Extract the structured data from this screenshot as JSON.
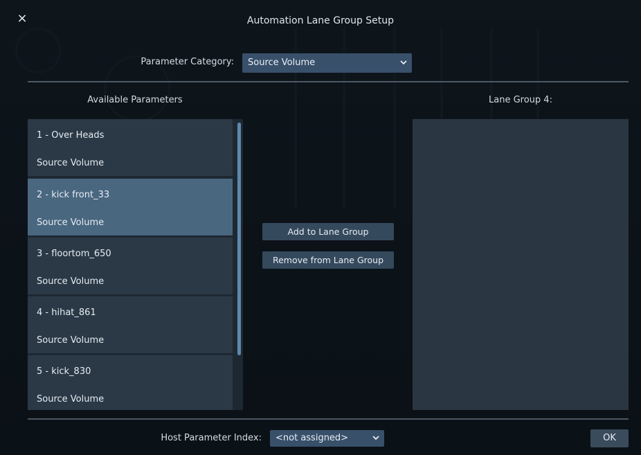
{
  "dialog": {
    "title": "Automation Lane Group Setup",
    "close_glyph": "×"
  },
  "parameter_category": {
    "label": "Parameter Category:",
    "selected": "Source Volume"
  },
  "available": {
    "header": "Available Parameters",
    "items": [
      {
        "name": "1 - Over Heads",
        "parameter": "Source Volume",
        "selected": false
      },
      {
        "name": "2 - kick front_33",
        "parameter": "Source Volume",
        "selected": true
      },
      {
        "name": "3 - floortom_650",
        "parameter": "Source Volume",
        "selected": false
      },
      {
        "name": "4 - hihat_861",
        "parameter": "Source Volume",
        "selected": false
      },
      {
        "name": "5 - kick_830",
        "parameter": "Source Volume",
        "selected": false
      }
    ]
  },
  "lane_group": {
    "header": "Lane Group 4:"
  },
  "buttons": {
    "add": "Add to Lane Group",
    "remove": "Remove from Lane Group",
    "ok": "OK"
  },
  "host_parameter": {
    "label": "Host Parameter Index:",
    "selected": "<not assigned>"
  },
  "icons": {
    "close": "close-icon",
    "dropdown": "chevron-down-icon"
  }
}
